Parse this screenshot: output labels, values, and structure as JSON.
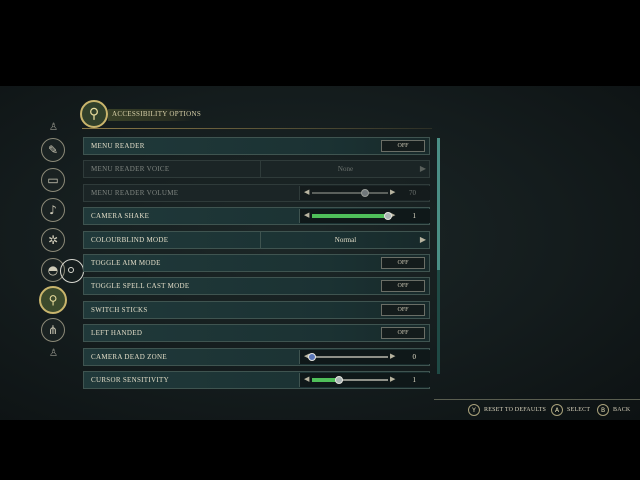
{
  "header": {
    "title": "ACCESSIBILITY OPTIONS",
    "emblem_icon": "accessibility-figure-icon"
  },
  "sidebar": {
    "items": [
      {
        "icon": "small-top-glyph-icon"
      },
      {
        "icon": "compass-icon"
      },
      {
        "icon": "display-icon"
      },
      {
        "icon": "speaker-icon"
      },
      {
        "icon": "gear-icon"
      },
      {
        "icon": "controller-icon"
      },
      {
        "icon": "accessibility-icon",
        "active": true
      },
      {
        "icon": "share-network-icon"
      },
      {
        "icon": "small-bottom-glyph-icon"
      }
    ]
  },
  "settings": [
    {
      "label": "MENU READER",
      "type": "toggle",
      "value": "OFF"
    },
    {
      "label": "MENU READER VOICE",
      "type": "selector",
      "value": "None",
      "disabled": true
    },
    {
      "label": "MENU READER VOLUME",
      "type": "slider",
      "value": "70",
      "level": 70,
      "disabled": true
    },
    {
      "label": "CAMERA SHAKE",
      "type": "slider",
      "value": "1",
      "level": 100
    },
    {
      "label": "COLOURBLIND MODE",
      "type": "selector",
      "value": "Normal"
    },
    {
      "label": "TOGGLE AIM MODE",
      "type": "toggle",
      "value": "OFF"
    },
    {
      "label": "TOGGLE SPELL CAST MODE",
      "type": "toggle",
      "value": "OFF"
    },
    {
      "label": "SWITCH STICKS",
      "type": "toggle",
      "value": "OFF"
    },
    {
      "label": "LEFT HANDED",
      "type": "toggle",
      "value": "OFF"
    },
    {
      "label": "CAMERA DEAD ZONE",
      "type": "slider",
      "value": "0",
      "level": 0
    },
    {
      "label": "CURSOR SENSITIVITY",
      "type": "slider",
      "value": "1",
      "level": 35
    }
  ],
  "footer": {
    "hints": [
      {
        "button": "Y",
        "label": "RESET TO DEFAULTS"
      },
      {
        "button": "A",
        "label": "SELECT"
      },
      {
        "button": "B",
        "label": "BACK"
      }
    ]
  },
  "colors": {
    "accent_gold": "#c9b56c",
    "slider_fill": "#4fbf5a",
    "row_bg": "#1b3233",
    "scrollbar": "#4b8f86"
  }
}
